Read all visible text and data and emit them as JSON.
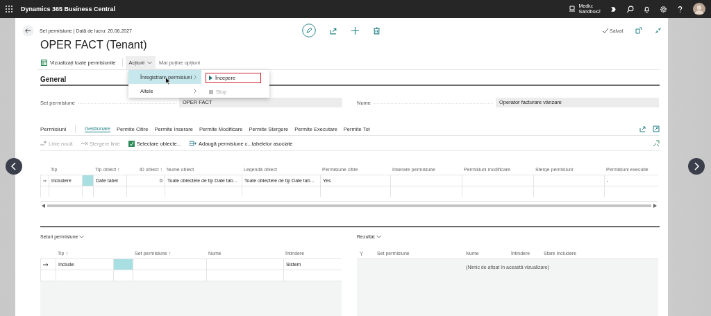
{
  "app": {
    "title": "Dynamics 365 Business Central",
    "environment": {
      "label": "Mediu:",
      "value": "Sandbox2"
    }
  },
  "page": {
    "breadcrumb": "Set permisiune | Dată de lucru: 20.06.2027",
    "title": "OPER FACT (Tenant)",
    "status": "Salvat"
  },
  "actions": [
    {
      "kind": "button",
      "label": "Vizualizați toate permisiunile"
    },
    {
      "kind": "menu",
      "label": "Acțiuni",
      "expanded": true
    },
    {
      "kind": "link",
      "label": "Mai puține opțiuni"
    }
  ],
  "menu": {
    "items": [
      {
        "label": "Înregistrare permisiuni",
        "selected": true
      },
      {
        "label": "Altele",
        "selected": false
      }
    ],
    "submenu": [
      {
        "kind": "play",
        "label": "Începere",
        "disabled": false,
        "highlighted": true
      },
      {
        "kind": "stop",
        "label": "Stop",
        "disabled": true,
        "highlighted": false
      }
    ]
  },
  "general": {
    "title": "General",
    "fields": [
      {
        "label": "Set permisiune",
        "value": "OPER FACT"
      },
      {
        "label": "Nume",
        "value": "Operator facturare vânzare"
      }
    ]
  },
  "permissions": {
    "title": "Permisiuni",
    "tabs": [
      {
        "label": "Gestionare",
        "selected": true
      },
      {
        "label": "Permite Citire",
        "selected": false
      },
      {
        "label": "Permite Inserare",
        "selected": false
      },
      {
        "label": "Permite Modificare",
        "selected": false
      },
      {
        "label": "Permite Ștergere",
        "selected": false
      },
      {
        "label": "Permite Executare",
        "selected": false
      },
      {
        "label": "Permite Tot",
        "selected": false
      }
    ],
    "toolbar": [
      {
        "kind": "new",
        "label": "Linie nouă",
        "disabled": true
      },
      {
        "kind": "delete",
        "label": "Ștergere linie",
        "disabled": true
      },
      {
        "kind": "select",
        "label": "Selectare obiecte...",
        "disabled": false
      },
      {
        "kind": "add",
        "label": "Adaugă permisiune c...tabelelor asociate",
        "disabled": false
      }
    ],
    "columns": [
      {
        "label": "Tip",
        "numeric": false
      },
      {
        "label": "Tip obiect ↑",
        "numeric": false
      },
      {
        "label": "ID obiect ↑",
        "numeric": true
      },
      {
        "label": "Nume obiect",
        "numeric": false
      },
      {
        "label": "Legendă obiect",
        "numeric": false
      },
      {
        "label": "Permisiune citire",
        "numeric": false
      },
      {
        "label": "Inserare permisiune",
        "numeric": false
      },
      {
        "label": "Permisiuni modificare",
        "numeric": false
      },
      {
        "label": "Șterge permisiuni",
        "numeric": false
      },
      {
        "label": "Permisiuni execuție",
        "numeric": false
      }
    ],
    "rows": [
      {
        "current": true,
        "cells": [
          "Includere",
          "Date tabel",
          "0",
          "Toate obiectele de tip Date tab...",
          "Toate obiectele de tip Date tab...",
          "Yes",
          null,
          null,
          null,
          "-"
        ]
      }
    ]
  },
  "sets": {
    "title": "Seturi permisiune",
    "columns": [
      "Tip ↑",
      "Set permisiune ↑",
      "Nume",
      "Întindere"
    ],
    "rows": [
      {
        "current": true,
        "cells": [
          "Include",
          null,
          null,
          "Sistem"
        ]
      }
    ]
  },
  "result": {
    "title": "Rezultat",
    "columns": [
      "Set permisiune",
      "Nume",
      "Întindere",
      "Stare includere"
    ],
    "empty": "(Nimic de afișat în această vizualizare)"
  }
}
